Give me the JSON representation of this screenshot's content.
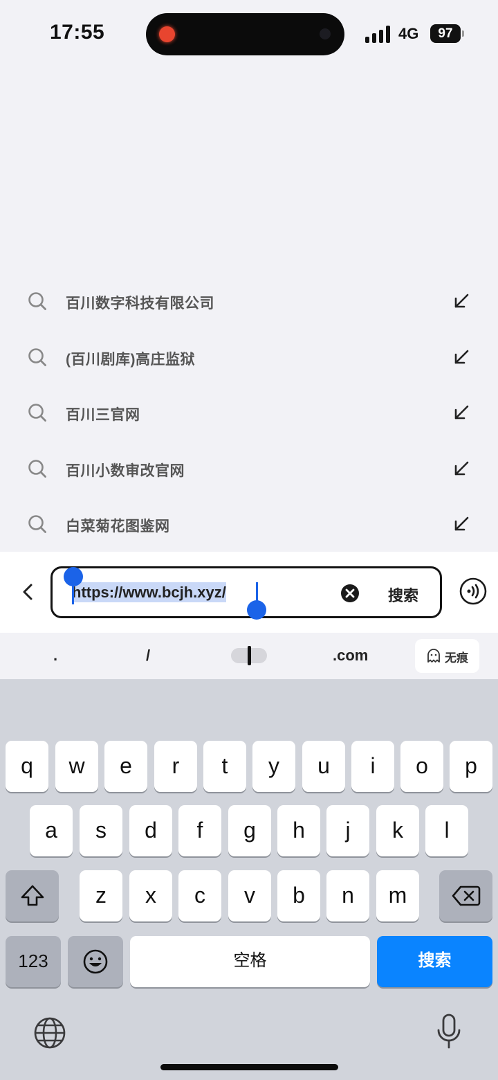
{
  "status_bar": {
    "time": "17:55",
    "network": "4G",
    "battery": "97"
  },
  "suggestions": [
    {
      "text": "百川数字科技有限公司"
    },
    {
      "text": "(百川剧库)高庄监狱"
    },
    {
      "text": "百川三官网"
    },
    {
      "text": "百川小数审改官网"
    },
    {
      "text": "白菜菊花图鉴网"
    }
  ],
  "search_bar": {
    "url": "https://www.bcjh.xyz/",
    "search_label": "搜索"
  },
  "quick_bar": {
    "dot": ".",
    "slash": "/",
    "com": ".com",
    "incognito": "无痕"
  },
  "keyboard": {
    "row1": [
      "q",
      "w",
      "e",
      "r",
      "t",
      "y",
      "u",
      "i",
      "o",
      "p"
    ],
    "row2": [
      "a",
      "s",
      "d",
      "f",
      "g",
      "h",
      "j",
      "k",
      "l"
    ],
    "row3": [
      "z",
      "x",
      "c",
      "v",
      "b",
      "n",
      "m"
    ],
    "numbers": "123",
    "space": "空格",
    "search": "搜索"
  },
  "colors": {
    "accent": "#0a84ff",
    "handle": "#1b63e8",
    "selection": "#c9d8f7"
  }
}
